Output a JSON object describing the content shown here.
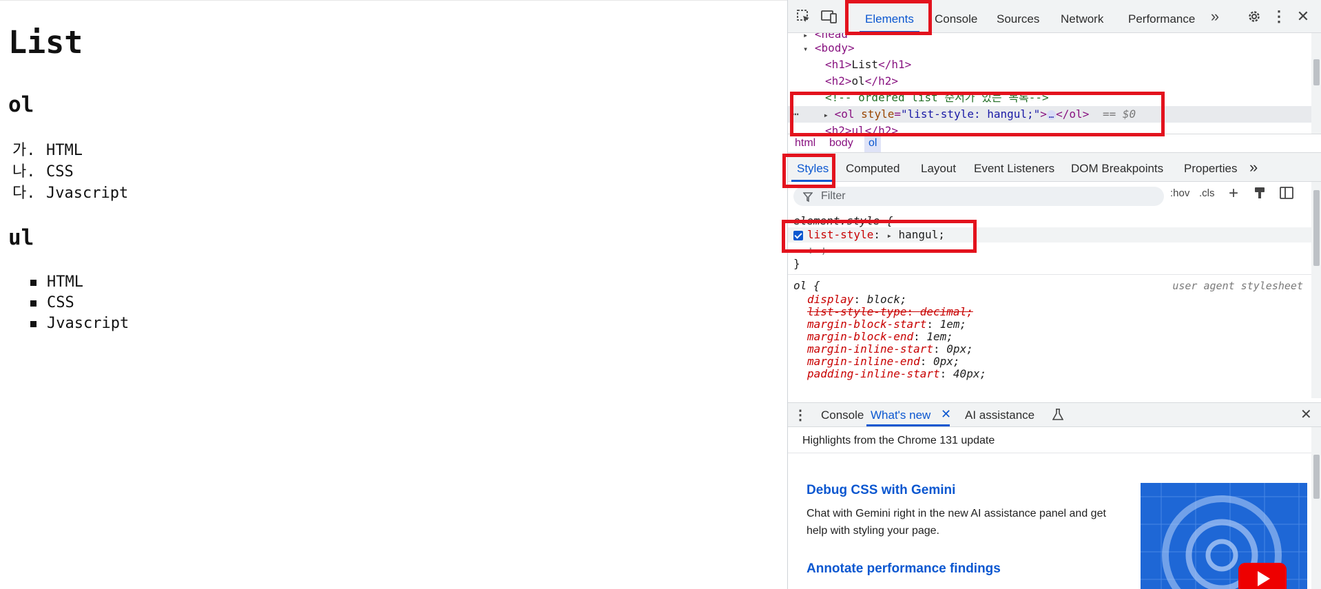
{
  "page": {
    "h1": "List",
    "h2_ol": "ol",
    "ol_items": [
      {
        "marker": "가.",
        "text": "HTML"
      },
      {
        "marker": "나.",
        "text": "CSS"
      },
      {
        "marker": "다.",
        "text": "Jvascript"
      }
    ],
    "h2_ul": "ul",
    "ul_items": [
      "HTML",
      "CSS",
      "Jvascript"
    ]
  },
  "devtools": {
    "tabs": [
      "Elements",
      "Console",
      "Sources",
      "Network",
      "Performance"
    ],
    "active_tab": "Elements",
    "dom": {
      "head_fragment": "<head",
      "body_open": "<body>",
      "h1_open": "<h1>",
      "h1_text": "List",
      "h1_close": "</h1>",
      "h2_open": "<h2>",
      "h2_text": "ol",
      "h2_close": "</h2>",
      "comment": "<!-- ordered list 순서가 있는 목록-->",
      "ol_open_start": "<ol ",
      "ol_attr_name": "style",
      "ol_attr_value": "\"list-style: hangul;\"",
      "ol_open_end": ">",
      "ol_close": "</ol>",
      "ellipsis": "…",
      "dollar": "== $0",
      "next_fragment": "<h2>ul</h2>"
    },
    "breadcrumbs": [
      "html",
      "body",
      "ol"
    ],
    "subtabs": [
      "Styles",
      "Computed",
      "Layout",
      "Event Listeners",
      "DOM Breakpoints",
      "Properties"
    ],
    "filter_placeholder": "Filter",
    "hov": ":hov",
    "cls": ".cls",
    "styles": {
      "element_style": "element.style {",
      "prop1_name": "list-style",
      "prop1_value": "hangul;",
      "close_brace": "}",
      "ol_selector": "ol {",
      "ua_source": "user agent stylesheet",
      "ua_rules": [
        {
          "name": "display",
          "value": "block;",
          "struck": false
        },
        {
          "name": "list-style-type",
          "value": "decimal;",
          "struck": true
        },
        {
          "name": "margin-block-start",
          "value": "1em;",
          "struck": false
        },
        {
          "name": "margin-block-end",
          "value": "1em;",
          "struck": false
        },
        {
          "name": "margin-inline-start",
          "value": "0px;",
          "struck": false
        },
        {
          "name": "margin-inline-end",
          "value": "0px;",
          "struck": false
        },
        {
          "name": "padding-inline-start",
          "value": "40px;",
          "struck": false
        }
      ]
    },
    "drawer": {
      "tabs": [
        "Console",
        "What's new",
        "AI assistance"
      ],
      "active": "What's new",
      "header": "Highlights from the Chrome 131 update",
      "h1": "Debug CSS with Gemini",
      "p1": "Chat with Gemini right in the new AI assistance panel and get help with styling your page.",
      "h2": "Annotate performance findings"
    }
  },
  "colors": {
    "accent": "#0b57d0",
    "annotation": "#e3121d",
    "tag": "#881280",
    "prop": "#c80000"
  }
}
